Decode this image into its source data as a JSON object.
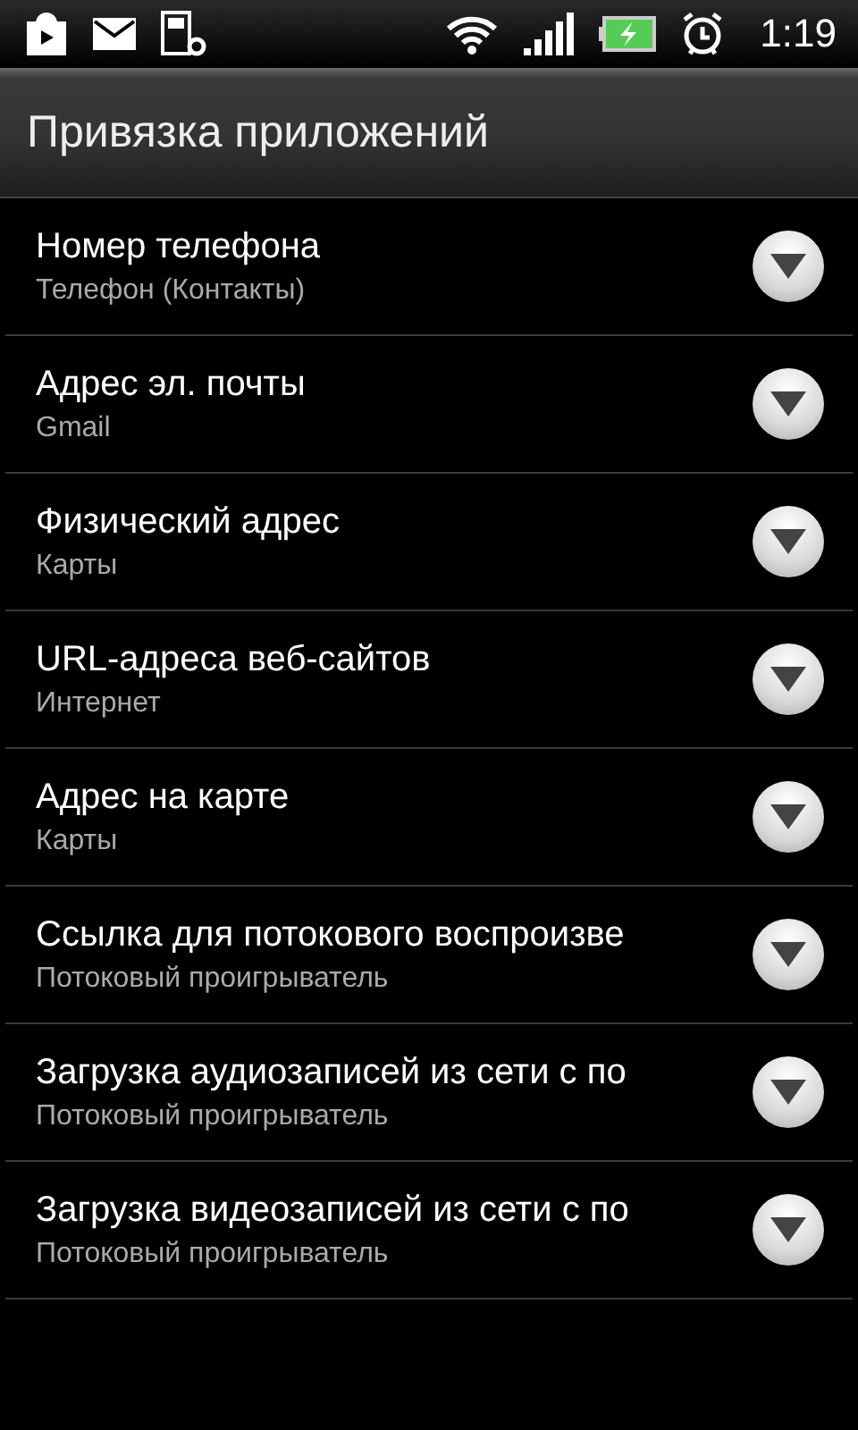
{
  "status_bar": {
    "time": "1:19"
  },
  "title": "Привязка приложений",
  "items": [
    {
      "title": "Номер телефона",
      "subtitle": "Телефон (Контакты)"
    },
    {
      "title": "Адрес эл. почты",
      "subtitle": "Gmail"
    },
    {
      "title": "Физический адрес",
      "subtitle": "Карты"
    },
    {
      "title": "URL-адреса веб-сайтов",
      "subtitle": "Интернет"
    },
    {
      "title": "Адрес на карте",
      "subtitle": "Карты"
    },
    {
      "title": "Ссылка для потокового воспроизве",
      "subtitle": "Потоковый проигрыватель"
    },
    {
      "title": "Загрузка аудиозаписей из сети с по",
      "subtitle": "Потоковый проигрыватель"
    },
    {
      "title": "Загрузка видеозаписей из сети с по",
      "subtitle": "Потоковый проигрыватель"
    }
  ]
}
